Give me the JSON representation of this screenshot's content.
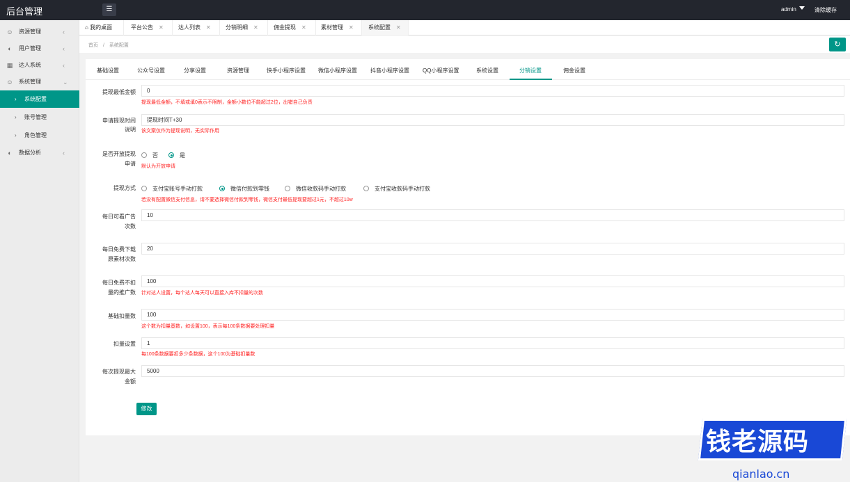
{
  "app": {
    "title": "后台管理",
    "menu_icon": "list-icon",
    "user": "admin",
    "clear_cache": "清除缓存"
  },
  "sidebar": {
    "groups": [
      {
        "label": "资源管理",
        "icon": "user-icon"
      },
      {
        "label": "用户管理",
        "icon": "gauge-icon"
      },
      {
        "label": "达人系统",
        "icon": "grid-icon"
      },
      {
        "label": "系统管理",
        "icon": "user-icon"
      }
    ],
    "sub_items": [
      {
        "label": "系统配置",
        "active": true
      },
      {
        "label": "账号管理",
        "active": false
      },
      {
        "label": "角色管理",
        "active": false
      }
    ],
    "last_group": {
      "label": "数据分析",
      "icon": "gauge-icon"
    }
  },
  "tabs": [
    {
      "label": "我的桌面",
      "closable": false
    },
    {
      "label": "平台公告",
      "closable": true
    },
    {
      "label": "达人列表",
      "closable": true
    },
    {
      "label": "分销明细",
      "closable": true
    },
    {
      "label": "佣金提现",
      "closable": true
    },
    {
      "label": "素材管理",
      "closable": true
    },
    {
      "label": "系统配置",
      "closable": true,
      "active": true
    }
  ],
  "breadcrumb": {
    "home": "首页",
    "sep": "/",
    "current": "系统配置"
  },
  "subtabs": [
    "基础设置",
    "公众号设置",
    "分享设置",
    "资源管理",
    "快手小程序设置",
    "微信小程序设置",
    "抖音小程序设置",
    "QQ小程序设置",
    "系统设置",
    "分销设置",
    "佣金设置"
  ],
  "active_subtab": "分销设置",
  "form": {
    "min_withdraw": {
      "label": "提现最低金额",
      "value": "0",
      "hint": "提现最低金额，不填或填0表示不限制，金额小数位不能超过2位，出错自己负责"
    },
    "withdraw_time": {
      "label_1": "申请提现时间",
      "label_2": "说明",
      "value": "提现时间T+30",
      "hint": "该文案仅作为提现说明，无实际作用"
    },
    "open_withdraw": {
      "label_1": "是否开放提现",
      "label_2": "申请",
      "options": [
        "否",
        "是"
      ],
      "selected": "是",
      "hint": "默认为开放申请"
    },
    "withdraw_method": {
      "label": "提现方式",
      "options": [
        "支付宝账号手动打款",
        "微信付款到零钱",
        "微信收款码手动打款",
        "支付宝收款码手动打款"
      ],
      "selected": "微信付款到零钱",
      "hint": "若没有配置微信支付信息，请不要选择微信付款到零钱，微信支付最低提现要超过1元，不超过10w"
    },
    "daily_ads": {
      "label_1": "每日可看广告",
      "label_2": "次数",
      "value": "10"
    },
    "daily_download": {
      "label_1": "每日免费下载",
      "label_2": "原素材次数",
      "value": "20"
    },
    "daily_no_deduct": {
      "label_1": "每日免费不扣",
      "label_2": "量的推广数",
      "value": "100",
      "hint": "针对达人设置，每个达人每天可以直接入库不扣量的次数"
    },
    "base_deduct": {
      "label": "基础扣量数",
      "value": "100",
      "hint": "这个数为扣量基数，如设置100，表示每100条数据要处理扣量"
    },
    "deduct_setting": {
      "label": "扣量设置",
      "value": "1",
      "hint": "每100条数据要扣多少条数据，这个100为基础扣量数"
    },
    "max_withdraw": {
      "label_1": "每次提现最大",
      "label_2": "金额",
      "value": "5000"
    },
    "submit": "修改"
  },
  "watermark": {
    "text": "钱老源码",
    "url": "qianlao.cn"
  },
  "colors": {
    "accent": "#009688",
    "topbar": "#23262e",
    "hint": "#ff2222",
    "watermark": "#1948d6"
  }
}
